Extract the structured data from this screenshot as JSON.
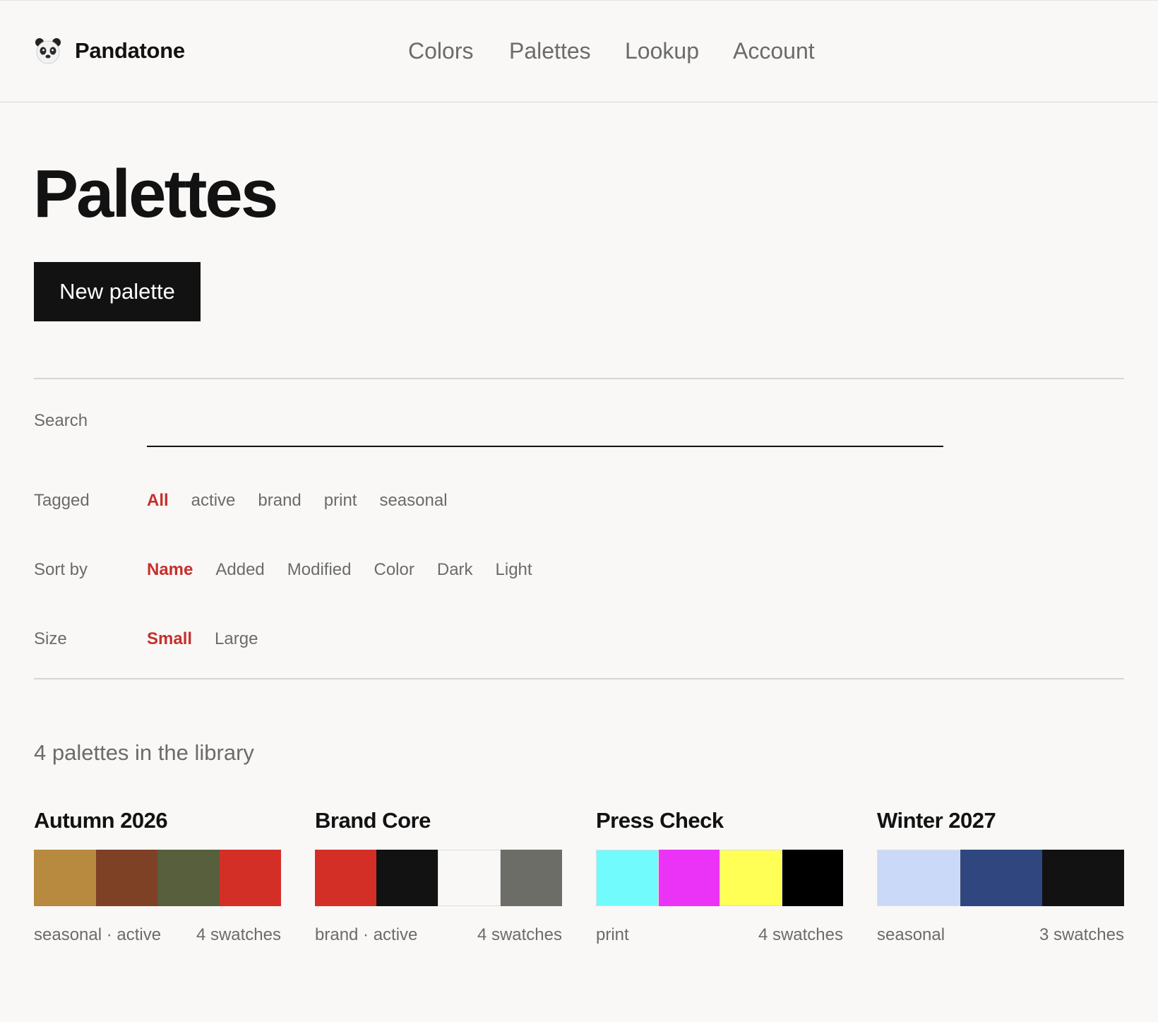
{
  "app": {
    "name": "Pandatone"
  },
  "nav": {
    "items": [
      "Colors",
      "Palettes",
      "Lookup",
      "Account"
    ]
  },
  "page": {
    "title": "Palettes",
    "new_button": "New palette"
  },
  "filters": {
    "search_label": "Search",
    "search_value": "",
    "tagged": {
      "label": "Tagged",
      "options": [
        "All",
        "active",
        "brand",
        "print",
        "seasonal"
      ],
      "selected": "All"
    },
    "sort": {
      "label": "Sort by",
      "options": [
        "Name",
        "Added",
        "Modified",
        "Color",
        "Dark",
        "Light"
      ],
      "selected": "Name"
    },
    "size": {
      "label": "Size",
      "options": [
        "Small",
        "Large"
      ],
      "selected": "Small"
    }
  },
  "library": {
    "count_text": "4 palettes in the library",
    "palettes": [
      {
        "name": "Autumn 2026",
        "tags": "seasonal · active",
        "count": "4 swatches",
        "colors": [
          "#b88a3f",
          "#7f4126",
          "#575f3d",
          "#d32f27"
        ]
      },
      {
        "name": "Brand Core",
        "tags": "brand · active",
        "count": "4 swatches",
        "colors": [
          "#d32f27",
          "#121212",
          "#f9f8f7",
          "#6d6d68"
        ]
      },
      {
        "name": "Press Check",
        "tags": "print",
        "count": "4 swatches",
        "colors": [
          "#72fbfd",
          "#ea33f7",
          "#ffff55",
          "#000000"
        ]
      },
      {
        "name": "Winter 2027",
        "tags": "seasonal",
        "count": "3 swatches",
        "colors": [
          "#cbd9f8",
          "#30467e",
          "#121212"
        ]
      }
    ]
  },
  "colors": {
    "accent": "#c5302b",
    "text": "#121212",
    "muted": "#6b6b6b",
    "background": "#f9f8f7"
  }
}
